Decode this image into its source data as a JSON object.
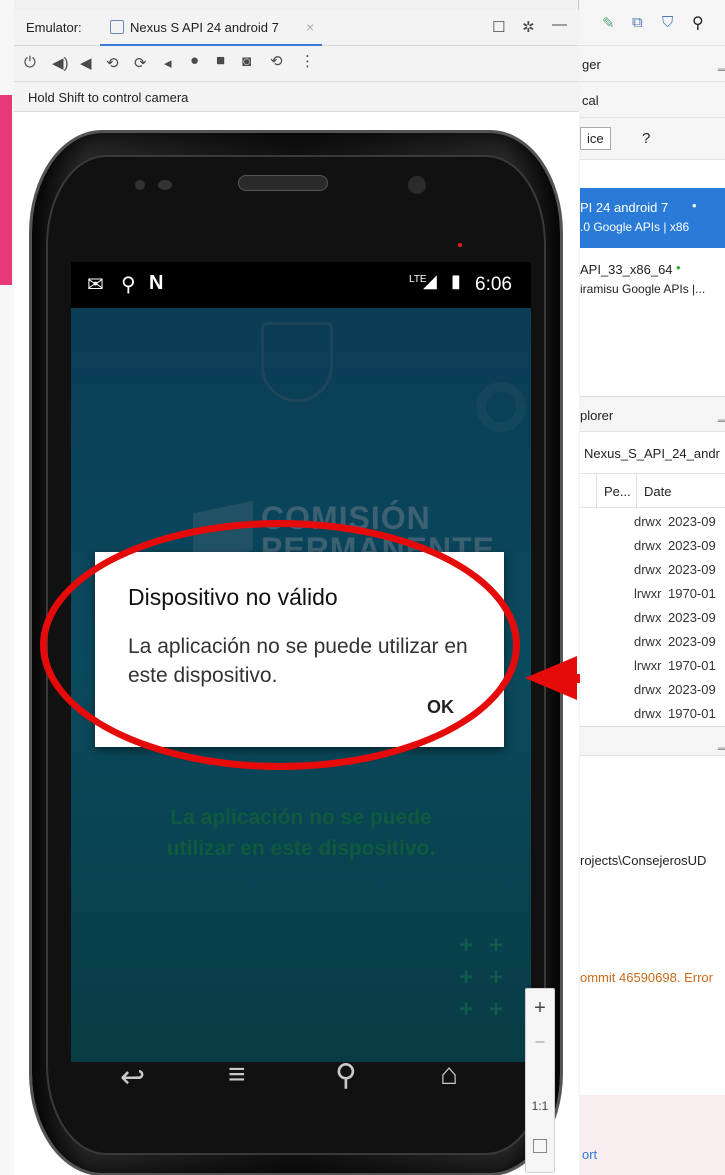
{
  "emulator": {
    "label": "Emulator:",
    "tab_title": "Nexus S API 24 android 7",
    "hint": "Hold Shift to control camera"
  },
  "phone": {
    "status_time": "6:06",
    "network": "LTE",
    "logo_text": [
      "COMISIÓN",
      "PERMANENTE"
    ],
    "bg_message": "La aplicación no se puede utilizar en este dispositivo.",
    "dialog": {
      "title": "Dispositivo no válido",
      "message": "La aplicación no se puede utilizar en este dispositivo.",
      "ok": "OK"
    },
    "zoom": {
      "plus": "+",
      "minus": "–",
      "one": "1:1"
    }
  },
  "right_panel": {
    "header_frag": "ger",
    "local_frag": "cal",
    "btn_frag": "ice",
    "help": "?",
    "device1_line1": "PI 24 android 7",
    "device1_line2": ".0 Google APIs | x86",
    "device2_line1": "API_33_x86_64",
    "device2_line2": "iramisu Google APIs |...",
    "explorer": "plorer",
    "explorer_device": "Nexus_S_API_24_andr",
    "col_perm": "Pe...",
    "col_date": "Date",
    "files": [
      {
        "perm": "drwx",
        "date": "2023-09"
      },
      {
        "perm": "drwx",
        "date": "2023-09"
      },
      {
        "perm": "drwx",
        "date": "2023-09"
      },
      {
        "perm": "lrwxr",
        "date": "1970-01"
      },
      {
        "perm": "drwx",
        "date": "2023-09"
      },
      {
        "perm": "drwx",
        "date": "2023-09"
      },
      {
        "perm": "lrwxr",
        "date": "1970-01"
      },
      {
        "perm": "drwx",
        "date": "2023-09"
      },
      {
        "perm": "drwx",
        "date": "1970-01"
      }
    ],
    "path_frag": "rojects\\ConsejerosUD",
    "commit_frag": "ommit 46590698. Error",
    "bottom_frag": "ort"
  },
  "colors": {
    "accent": "#2a7bd8",
    "annotation": "#e60b0b",
    "screen_bg": "#0b4a5e"
  }
}
